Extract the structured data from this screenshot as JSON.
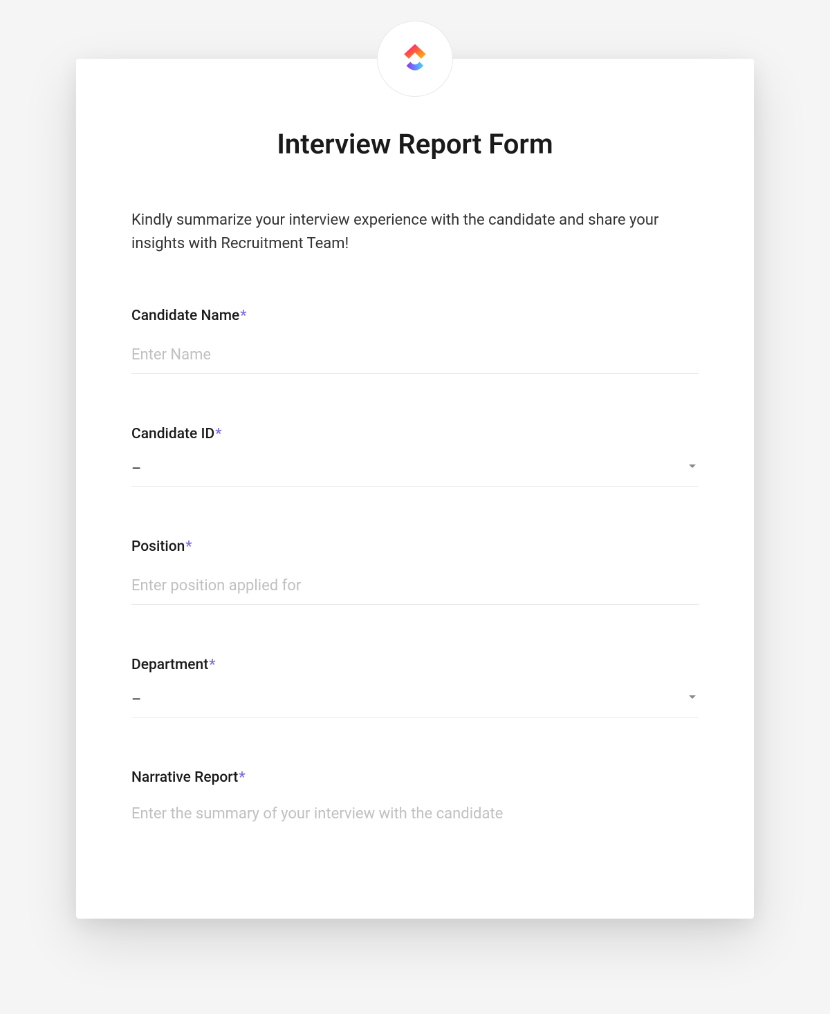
{
  "form": {
    "title": "Interview Report Form",
    "description": "Kindly summarize your interview experience with the candidate and share your insights with Recruitment Team!",
    "required_marker": "*",
    "fields": {
      "candidate_name": {
        "label": "Candidate Name",
        "placeholder": "Enter Name",
        "required": true
      },
      "candidate_id": {
        "label": "Candidate ID",
        "value": "–",
        "required": true
      },
      "position": {
        "label": "Position",
        "placeholder": "Enter position applied for",
        "required": true
      },
      "department": {
        "label": "Department",
        "value": "–",
        "required": true
      },
      "narrative_report": {
        "label": "Narrative Report",
        "placeholder": "Enter the summary of your interview with the candidate",
        "required": true
      }
    }
  },
  "logo": {
    "name": "clickup-logo"
  }
}
